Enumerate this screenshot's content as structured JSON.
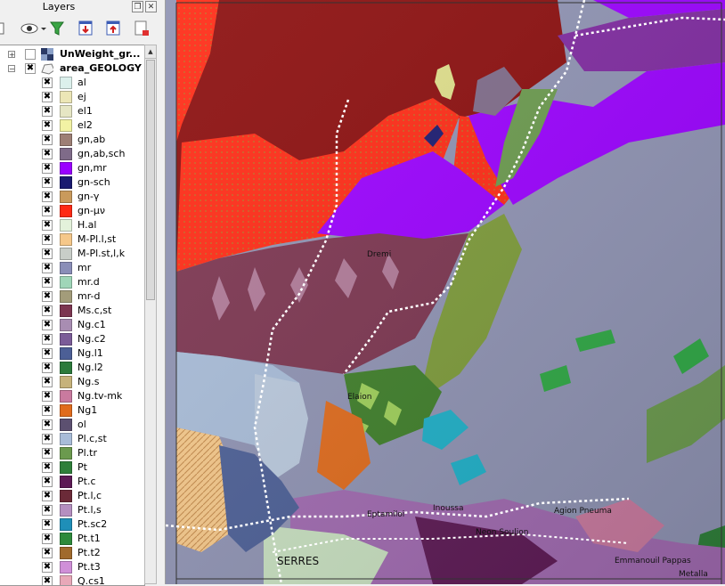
{
  "panel": {
    "title": "Layers"
  },
  "toolbar": {
    "buttons": [
      "eye-icon",
      "filter-icon",
      "expand-all-icon",
      "collapse-all-icon",
      "remove-layer-icon"
    ]
  },
  "layers": {
    "raster_layer": "UnWeight_gr...",
    "vector_layer": "area_GEOLOGY"
  },
  "legend": [
    {
      "label": "al",
      "color": "#dcf0ec"
    },
    {
      "label": "ej",
      "color": "#ece6b6"
    },
    {
      "label": "el1",
      "color": "#e6e6c4"
    },
    {
      "label": "el2",
      "color": "#f2f2a4"
    },
    {
      "label": "gn,ab",
      "color": "#9d7f75"
    },
    {
      "label": "gn,ab,sch",
      "color": "#7f6b89"
    },
    {
      "label": "gn,mr",
      "color": "#9a00ff"
    },
    {
      "label": "gn-sch",
      "color": "#1a1a70"
    },
    {
      "label": "gn-γ",
      "color": "#c99a5c"
    },
    {
      "label": "gn-μν",
      "color": "#ff2a14"
    },
    {
      "label": "H.al",
      "color": "#e3f2db"
    },
    {
      "label": "M-Pl.l,st",
      "color": "#f5c88a"
    },
    {
      "label": "M-Pl.st,l,k",
      "color": "#c8cec8"
    },
    {
      "label": "mr",
      "color": "#8a8eb8"
    },
    {
      "label": "mr.d",
      "color": "#9fd6b8"
    },
    {
      "label": "mr-d",
      "color": "#a39c7a"
    },
    {
      "label": "Ms.c,st",
      "color": "#7c3550"
    },
    {
      "label": "Ng.c1",
      "color": "#a88db2"
    },
    {
      "label": "Ng.c2",
      "color": "#7b5c98"
    },
    {
      "label": "Ng.l1",
      "color": "#4c5f96"
    },
    {
      "label": "Ng.l2",
      "color": "#2c7a3b"
    },
    {
      "label": "Ng.s",
      "color": "#c6b27a"
    },
    {
      "label": "Ng.tv-mk",
      "color": "#c97a9f"
    },
    {
      "label": "Ng1",
      "color": "#e06b1c"
    },
    {
      "label": "ol",
      "color": "#5c5070"
    },
    {
      "label": "Pl.c,st",
      "color": "#a8bcd8"
    },
    {
      "label": "Pl.tr",
      "color": "#6b9a4e"
    },
    {
      "label": "Pt",
      "color": "#2f7f3a"
    },
    {
      "label": "Pt.c",
      "color": "#5d1a55"
    },
    {
      "label": "Pt.l,c",
      "color": "#6b2a38"
    },
    {
      "label": "Pt.l,s",
      "color": "#b58fc0"
    },
    {
      "label": "Pt.sc2",
      "color": "#1f8fb8"
    },
    {
      "label": "Pt.t1",
      "color": "#2d8a3b"
    },
    {
      "label": "Pt.t2",
      "color": "#a06a2c"
    },
    {
      "label": "Pt.t3",
      "color": "#d08fd8"
    },
    {
      "label": "Q.cs1",
      "color": "#e8a8b8"
    }
  ],
  "map": {
    "place_labels": {
      "serres": "SERRES",
      "dremi": "Dremi",
      "elaion": "Elaion",
      "eptamiloi": "Eptamiloi",
      "iraklia": "Inoussa",
      "agion_pneuma": "Agion Pneuma",
      "neon_soulion": "Neon Soulion",
      "emmanouil_pappas": "Emmanouil Pappas",
      "metalla": "Metalla"
    }
  }
}
